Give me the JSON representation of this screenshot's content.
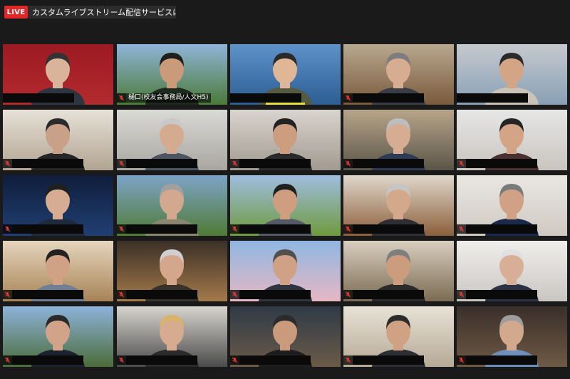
{
  "live": {
    "badge": "LIVE",
    "stream_text": "カスタムライブストリーム配信サービスに参加中"
  },
  "colors": {
    "live_red": "#e02828",
    "active_border": "#e8e13a",
    "muted_mic": "#e23a3a"
  },
  "tiles": [
    {
      "name": "",
      "muted": false,
      "active": true,
      "bg": [
        "#9c1a22",
        "#b22b2e"
      ],
      "skin": "#d9b49a",
      "hair": "#333333",
      "shirt": "#2e3440"
    },
    {
      "name": "樋口(校友会事務局/人文H5)",
      "muted": true,
      "active": false,
      "bg": [
        "#8fb4d8",
        "#4b7a38"
      ],
      "skin": "#c99b7a",
      "hair": "#1e1e1e",
      "shirt": "#1f2a1f"
    },
    {
      "name": "",
      "muted": false,
      "active": false,
      "bg": [
        "#5f92c9",
        "#2c5e94"
      ],
      "skin": "#e0b796",
      "hair": "#2a2a2a",
      "shirt": "#545b42",
      "speaking": true
    },
    {
      "name": "",
      "muted": true,
      "active": false,
      "bg": [
        "#b9a88f",
        "#7a5a3c"
      ],
      "skin": "#d7ad92",
      "hair": "#7d7d7d",
      "shirt": "#3a3d45"
    },
    {
      "name": "",
      "muted": false,
      "active": false,
      "bg": [
        "#c6c9cf",
        "#88a0b4"
      ],
      "skin": "#d3a585",
      "hair": "#2a2a2a",
      "shirt": "#c9c3b8"
    },
    {
      "name": "",
      "muted": true,
      "active": false,
      "bg": [
        "#e7e1d8",
        "#b2a491"
      ],
      "skin": "#c9a088",
      "hair": "#2b2b2b",
      "shirt": "#262626"
    },
    {
      "name": "",
      "muted": true,
      "active": false,
      "bg": [
        "#d9d9d6",
        "#a9a6a0"
      ],
      "skin": "#d5ab90",
      "hair": "#c8c8c8",
      "shirt": "#4d5560"
    },
    {
      "name": "",
      "muted": true,
      "active": false,
      "bg": [
        "#d9d4ce",
        "#a29a90"
      ],
      "skin": "#cc9d7f",
      "hair": "#222222",
      "shirt": "#2a2a2a"
    },
    {
      "name": "",
      "muted": true,
      "active": false,
      "bg": [
        "#b7a58a",
        "#5b5547"
      ],
      "skin": "#d6ad93",
      "hair": "#bdbdbd",
      "shirt": "#2d3b57"
    },
    {
      "name": "",
      "muted": true,
      "active": false,
      "bg": [
        "#e6e6e6",
        "#c9c4bf"
      ],
      "skin": "#d3a486",
      "hair": "#252525",
      "shirt": "#4a3030"
    },
    {
      "name": "",
      "muted": true,
      "active": false,
      "bg": [
        "#0f1e3b",
        "#213f73"
      ],
      "skin": "#d6ad93",
      "hair": "#1f1f1f",
      "shirt": "#1f2b3c"
    },
    {
      "name": "",
      "muted": true,
      "active": false,
      "bg": [
        "#7da3c7",
        "#4f7b35"
      ],
      "skin": "#d2a98f",
      "hair": "#a0a0a0",
      "shirt": "#8a8670"
    },
    {
      "name": "",
      "muted": true,
      "active": false,
      "bg": [
        "#9fbde0",
        "#6f9a3e"
      ],
      "skin": "#cf9e80",
      "hair": "#202020",
      "shirt": "#545b66"
    },
    {
      "name": "",
      "muted": true,
      "active": false,
      "bg": [
        "#e0d8cc",
        "#8c5f3b"
      ],
      "skin": "#d4a88b",
      "hair": "#c5c5c5",
      "shirt": "#2e2e33"
    },
    {
      "name": "",
      "muted": true,
      "active": false,
      "bg": [
        "#eae7e3",
        "#cfc9c1"
      ],
      "skin": "#d0a184",
      "hair": "#7a7a7a",
      "shirt": "#1c2a4a"
    },
    {
      "name": "",
      "muted": true,
      "active": false,
      "bg": [
        "#e5d5bd",
        "#a78456"
      ],
      "skin": "#d1a185",
      "hair": "#222222",
      "shirt": "#6e7f95"
    },
    {
      "name": "",
      "muted": true,
      "active": false,
      "bg": [
        "#3b3027",
        "#a47a4b"
      ],
      "skin": "#d4a78d",
      "hair": "#cfcfcf",
      "shirt": "#39322b"
    },
    {
      "name": "",
      "muted": true,
      "active": false,
      "bg": [
        "#8fb7e2",
        "#e6b7c4"
      ],
      "skin": "#d0a184",
      "hair": "#505050",
      "shirt": "#2f3440"
    },
    {
      "name": "",
      "muted": true,
      "active": false,
      "bg": [
        "#d9cfbf",
        "#7b6b52"
      ],
      "skin": "#cc9c7e",
      "hair": "#7f7f7f",
      "shirt": "#2b2b2b"
    },
    {
      "name": "",
      "muted": true,
      "active": false,
      "bg": [
        "#f0eeec",
        "#c9c6c2"
      ],
      "skin": "#d8ae96",
      "hair": "#e0e0e0",
      "shirt": "#2b3244"
    },
    {
      "name": "",
      "muted": true,
      "active": false,
      "bg": [
        "#8db3da",
        "#4c6c3a"
      ],
      "skin": "#d1a388",
      "hair": "#2a2a2a",
      "shirt": "#1c2230"
    },
    {
      "name": "",
      "muted": true,
      "active": false,
      "bg": [
        "#d7d4cf",
        "#4b4b4b"
      ],
      "skin": "#d6ab90",
      "hair": "#d8b46a",
      "shirt": "#2b2b2b"
    },
    {
      "name": "",
      "muted": true,
      "active": false,
      "bg": [
        "#2f3a47",
        "#6b5b48"
      ],
      "skin": "#c99a7c",
      "hair": "#2b2b2b",
      "shirt": "#1d1d1d"
    },
    {
      "name": "",
      "muted": true,
      "active": false,
      "bg": [
        "#e8e2d7",
        "#b6a995"
      ],
      "skin": "#d0a183",
      "hair": "#2b2b2b",
      "shirt": "#2d2f35"
    },
    {
      "name": "",
      "muted": true,
      "active": false,
      "bg": [
        "#3a2f2a",
        "#6e5a45"
      ],
      "skin": "#d3a98e",
      "hair": "#9d9d9d",
      "shirt": "#6d8fb8"
    }
  ]
}
